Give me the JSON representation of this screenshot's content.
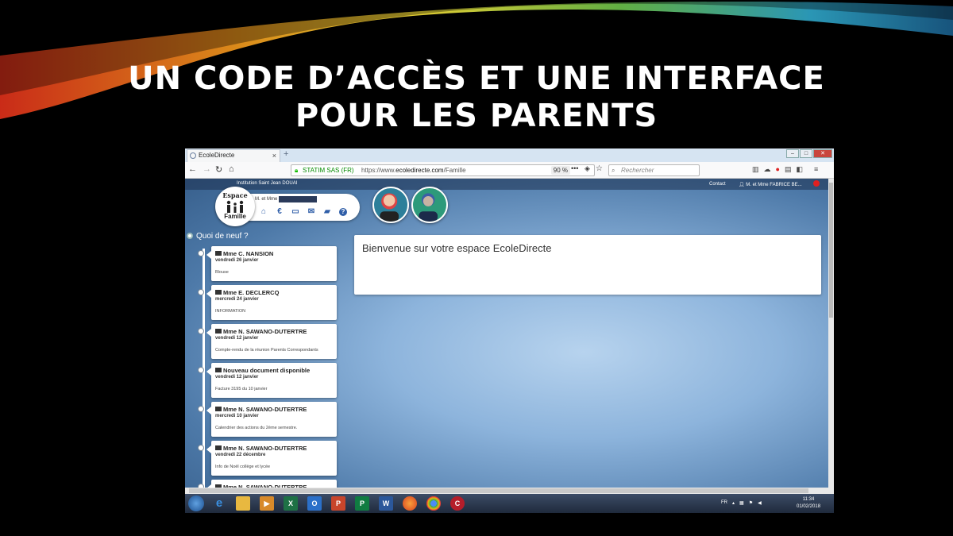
{
  "slide": {
    "title_line1": "UN CODE D’ACCÈS ET UNE INTERFACE",
    "title_line2": "POUR LES PARENTS"
  },
  "browser": {
    "tab_title": "EcoleDirecte",
    "tab_close": "×",
    "new_tab": "+",
    "url_org": "STATIM SAS (FR)",
    "url_prefix": "https://www.",
    "url_domain": "ecoledirecte.com",
    "url_path": "/Famille",
    "zoom": "90 %",
    "search_placeholder": "Rechercher"
  },
  "page": {
    "institution": "Institution Saint Jean DOUAI",
    "contact": "Contact",
    "user": "M. et Mme FABRICE BE...",
    "logo_top": "Espace",
    "logo_bottom": "Famille",
    "menu_name": "M. et Mme",
    "news_heading": "Quoi de neuf ?",
    "welcome": "Bienvenue sur votre espace EcoleDirecte",
    "news": [
      {
        "author": "Mme C. NANSION",
        "date": "vendredi 26 janvier",
        "text": "Blouse",
        "icon": "envelope-icon"
      },
      {
        "author": "Mme E. DECLERCQ",
        "date": "mercredi 24 janvier",
        "text": "INFORMATION",
        "icon": "envelope-icon"
      },
      {
        "author": "Mme N. SAWANO-DUTERTRE",
        "date": "vendredi 12 janvier",
        "text": "Compte-rendu de la réunion Parents Correspondants",
        "icon": "envelope-icon"
      },
      {
        "author": "Nouveau document disponible",
        "date": "vendredi 12 janvier",
        "text": "Facture 3195 du 10 janvier",
        "icon": "folder-icon"
      },
      {
        "author": "Mme N. SAWANO-DUTERTRE",
        "date": "mercredi 10 janvier",
        "text": "Calendrier des actions du 2ème semestre.",
        "icon": "envelope-icon"
      },
      {
        "author": "Mme N. SAWANO-DUTERTRE",
        "date": "vendredi 22 décembre",
        "text": "Info de Noël collège et lycée",
        "icon": "envelope-icon"
      },
      {
        "author": "Mme N. SAWANO-DUTERTRE",
        "date": "",
        "text": "",
        "icon": "envelope-icon"
      }
    ]
  },
  "taskbar": {
    "lang": "FR",
    "time": "11:34",
    "date": "01/02/2018"
  }
}
